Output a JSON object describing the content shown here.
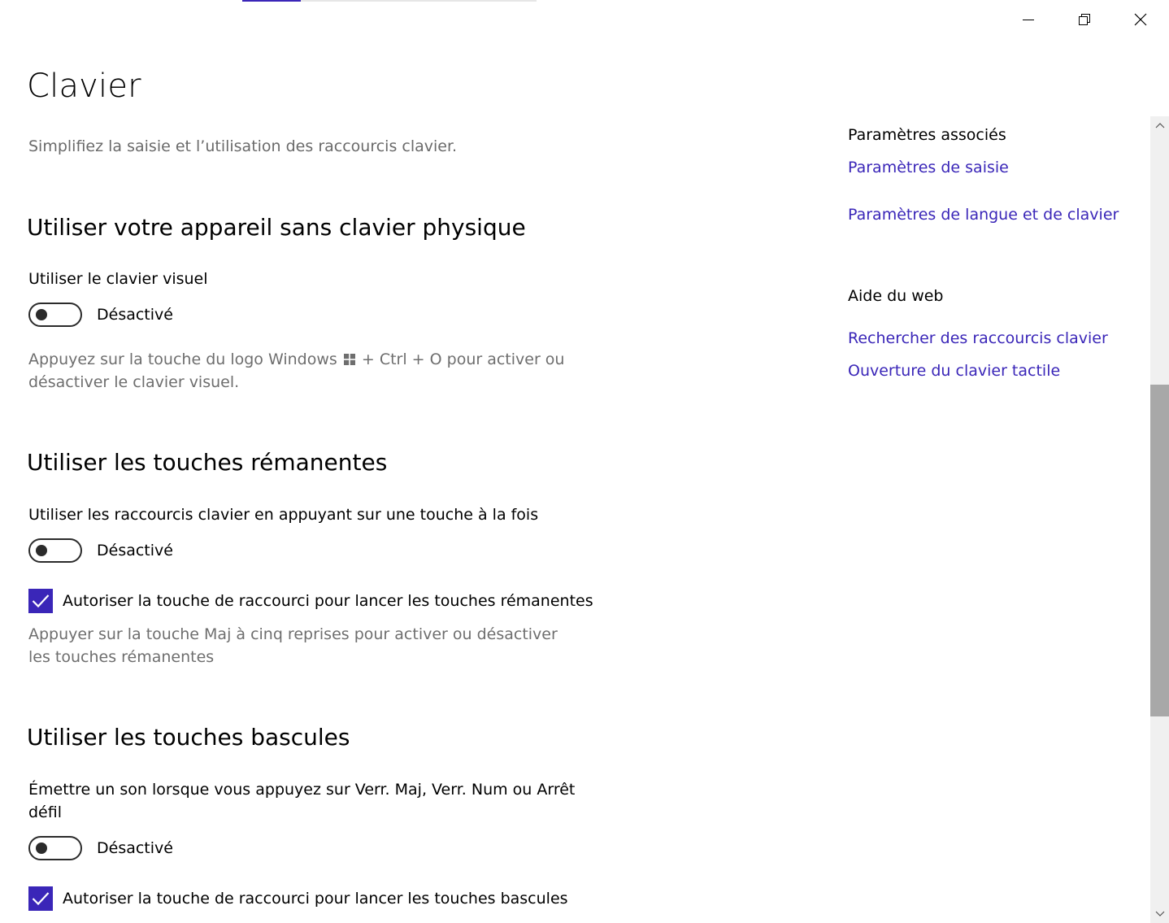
{
  "window": {
    "controls": {
      "minimize_icon": "minimize-icon",
      "restore_icon": "restore-icon",
      "close_icon": "close-icon"
    },
    "loading_progress": 0.2
  },
  "page": {
    "title": "Clavier",
    "subtitle": "Simplifiez la saisie et l’utilisation des raccourcis clavier."
  },
  "sections": {
    "no_physical_keyboard": {
      "heading": "Utiliser votre appareil sans clavier physique",
      "option_label": "Utiliser le clavier visuel",
      "toggle_state": "Désactivé",
      "toggle_on": false,
      "helper_before_logo": "Appuyez sur la touche du logo Windows",
      "helper_after_logo": " + Ctrl + O pour activer ou désactiver le clavier visuel."
    },
    "sticky_keys": {
      "heading": "Utiliser les touches rémanentes",
      "option_label": "Utiliser les raccourcis clavier en appuyant sur une touche à la fois",
      "toggle_state": "Désactivé",
      "toggle_on": false,
      "checkbox_label": "Autoriser la touche de raccourci pour lancer les touches rémanentes",
      "checkbox_checked": true,
      "helper": "Appuyer sur la touche Maj à cinq reprises pour activer ou désactiver les touches rémanentes"
    },
    "toggle_keys": {
      "heading": "Utiliser les touches bascules",
      "option_label": "Émettre un son lorsque vous appuyez sur Verr. Maj, Verr. Num ou Arrêt défil",
      "toggle_state": "Désactivé",
      "toggle_on": false,
      "checkbox_label": "Autoriser la touche de raccourci pour lancer les touches bascules",
      "checkbox_checked": true
    }
  },
  "related": {
    "heading": "Paramètres associés",
    "links": [
      "Paramètres de saisie",
      "Paramètres de langue et de clavier"
    ]
  },
  "web_help": {
    "heading": "Aide du web",
    "links": [
      "Rechercher des raccourcis clavier",
      "Ouverture du clavier tactile"
    ]
  },
  "scrollbar": {
    "position": 0.57,
    "visible_fraction": 0.43
  },
  "colors": {
    "accent": "#3a26b8",
    "secondary_text": "#6e6e6e",
    "scroll_track": "#f0f0f0",
    "scroll_thumb": "#a8a8a8"
  }
}
